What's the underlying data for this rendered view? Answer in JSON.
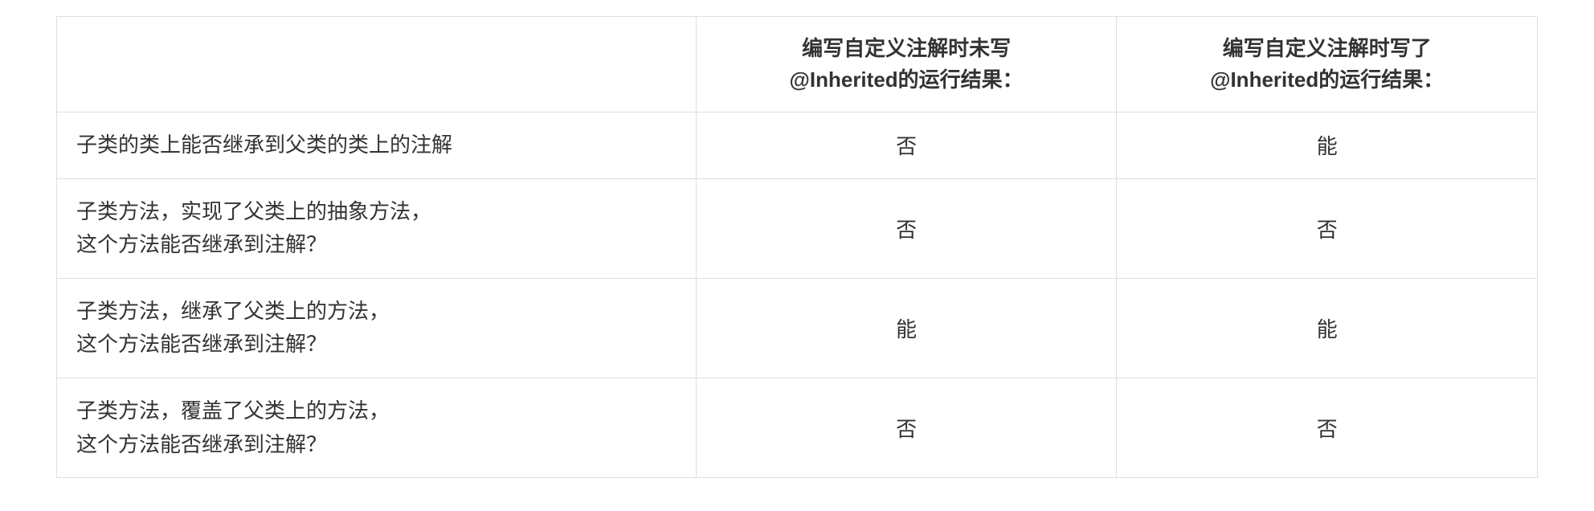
{
  "table": {
    "headers": {
      "col0": "",
      "col1_line1": "编写自定义注解时未写",
      "col1_line2": "@Inherited的运行结果：",
      "col2_line1": "编写自定义注解时写了",
      "col2_line2": "@Inherited的运行结果："
    },
    "rows": [
      {
        "label_line1": "子类的类上能否继承到父类的类上的注解",
        "label_line2": "",
        "col1": "否",
        "col2": "能"
      },
      {
        "label_line1": "子类方法，实现了父类上的抽象方法，",
        "label_line2": "这个方法能否继承到注解？",
        "col1": "否",
        "col2": "否"
      },
      {
        "label_line1": "子类方法，继承了父类上的方法，",
        "label_line2": "这个方法能否继承到注解？",
        "col1": "能",
        "col2": "能"
      },
      {
        "label_line1": "子类方法，覆盖了父类上的方法，",
        "label_line2": "这个方法能否继承到注解？",
        "col1": "否",
        "col2": "否"
      }
    ]
  }
}
